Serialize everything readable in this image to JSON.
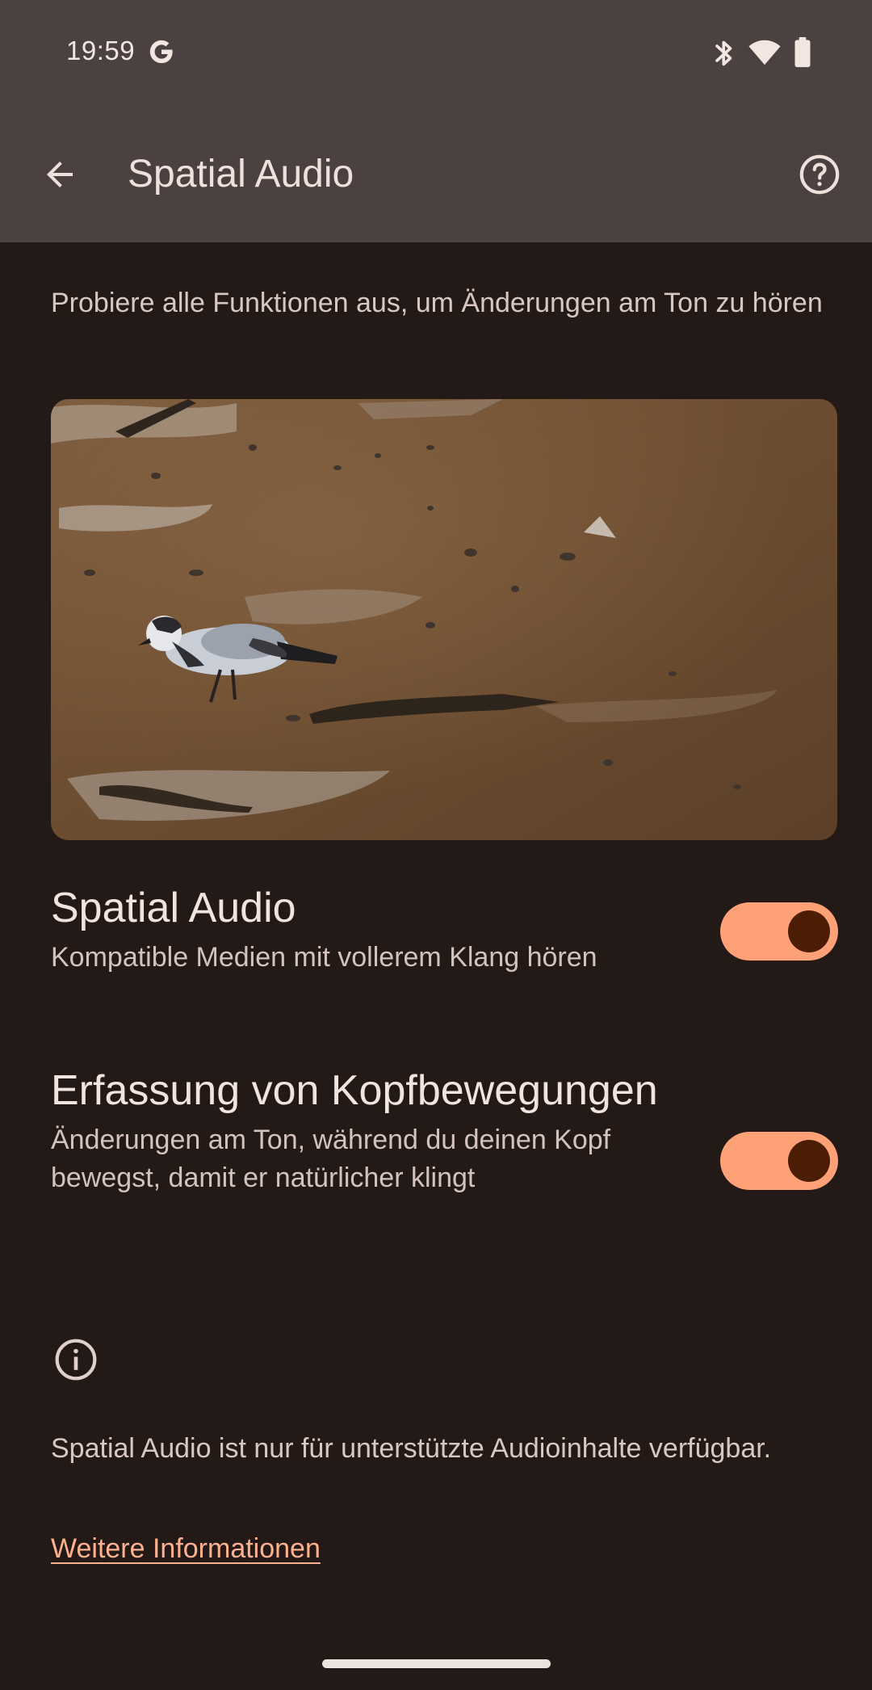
{
  "status_bar": {
    "time": "19:59",
    "icons": [
      "google-g-icon",
      "bluetooth-icon",
      "wifi-icon",
      "battery-icon"
    ]
  },
  "app_bar": {
    "title": "Spatial Audio",
    "back_icon": "arrow-back-icon",
    "help_icon": "help-circle-icon"
  },
  "intro_text": "Probiere alle Funktionen aus, um Änderungen am Ton zu hören",
  "preview_image": {
    "subject": "bird-on-mudflat"
  },
  "settings": [
    {
      "title": "Spatial Audio",
      "summary": "Kompatible Medien mit vollerem Klang hören",
      "enabled": true
    },
    {
      "title": "Erfassung von Kopfbewegungen",
      "summary": "Änderungen am Ton, während du deinen Kopf bewegst, damit er natürlicher klingt",
      "enabled": true
    }
  ],
  "footer": {
    "info_icon": "info-icon",
    "text": "Spatial Audio ist nur für unterstützte Audioinhalte verfügbar.",
    "link": "Weitere Informationen"
  },
  "colors": {
    "background": "#231a17",
    "top_bar": "#4a4140",
    "toggle_track": "#ffa176",
    "toggle_thumb": "#4a1d04",
    "link": "#ffb08e"
  }
}
